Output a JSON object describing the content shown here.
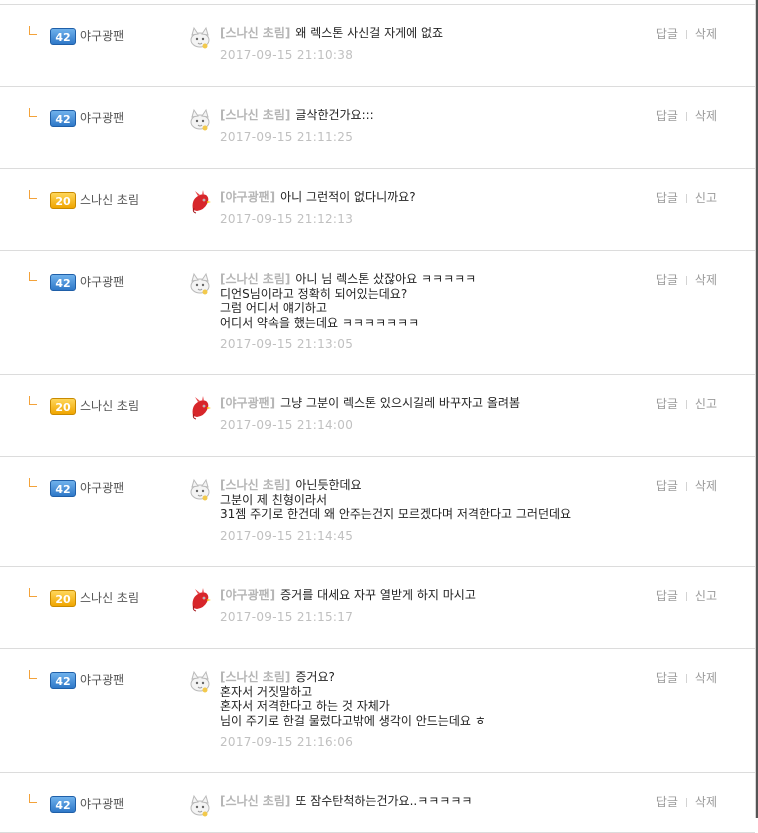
{
  "comments": [
    {
      "user_level": "42",
      "user_name": "야구광팬",
      "level_color": "blue",
      "avatar": "white-cat-avatar",
      "target": "[스나신 초림]",
      "lines": [
        "왜 렉스톤 사신걸 자게에 없죠"
      ],
      "timestamp": "2017-09-15 21:10:38",
      "reply_label": "답글",
      "action_label": "삭제"
    },
    {
      "user_level": "42",
      "user_name": "야구광팬",
      "level_color": "blue",
      "avatar": "white-cat-avatar",
      "target": "[스나신 초림]",
      "lines": [
        "글삭한건가요:::"
      ],
      "timestamp": "2017-09-15 21:11:25",
      "reply_label": "답글",
      "action_label": "삭제"
    },
    {
      "user_level": "20",
      "user_name": "스나신 초림",
      "level_color": "gold",
      "avatar": "red-bird-avatar",
      "target": "[야구광팬]",
      "lines": [
        "아니 그런적이 없다니까요?"
      ],
      "timestamp": "2017-09-15 21:12:13",
      "reply_label": "답글",
      "action_label": "신고"
    },
    {
      "user_level": "42",
      "user_name": "야구광팬",
      "level_color": "blue",
      "avatar": "white-cat-avatar",
      "target": "[스나신 초림]",
      "lines": [
        "아니 님 렉스톤 샀잖아요 ㅋㅋㅋㅋㅋ",
        "디언S님이라고 정확히 되어있는데요?",
        "그럼 어디서 얘기하고",
        "어디서 약속을 했는데요 ㅋㅋㅋㅋㅋㅋㅋ"
      ],
      "timestamp": "2017-09-15 21:13:05",
      "reply_label": "답글",
      "action_label": "삭제"
    },
    {
      "user_level": "20",
      "user_name": "스나신 초림",
      "level_color": "gold",
      "avatar": "red-bird-avatar",
      "target": "[야구광팬]",
      "lines": [
        "그냥 그분이 렉스톤 있으시길레 바꾸자고 올려봄"
      ],
      "timestamp": "2017-09-15 21:14:00",
      "reply_label": "답글",
      "action_label": "신고"
    },
    {
      "user_level": "42",
      "user_name": "야구광팬",
      "level_color": "blue",
      "avatar": "white-cat-avatar",
      "target": "[스나신 초림]",
      "lines": [
        "아닌듯한데요",
        "그분이 제 친형이라서",
        "31젬 주기로 한건데 왜 안주는건지 모르겠다며 저격한다고 그러던데요"
      ],
      "timestamp": "2017-09-15 21:14:45",
      "reply_label": "답글",
      "action_label": "삭제"
    },
    {
      "user_level": "20",
      "user_name": "스나신 초림",
      "level_color": "gold",
      "avatar": "red-bird-avatar",
      "target": "[야구광팬]",
      "lines": [
        "증거를 대세요 자꾸 열받게 하지 마시고"
      ],
      "timestamp": "2017-09-15 21:15:17",
      "reply_label": "답글",
      "action_label": "신고"
    },
    {
      "user_level": "42",
      "user_name": "야구광팬",
      "level_color": "blue",
      "avatar": "white-cat-avatar",
      "target": "[스나신 초림]",
      "lines": [
        "증거요?",
        "혼자서 거짓말하고",
        "혼자서 저격한다고 하는 것 자체가",
        "님이 주기로 한걸 물렀다고밖에 생각이 안드는데요 ㅎ"
      ],
      "timestamp": "2017-09-15 21:16:06",
      "reply_label": "답글",
      "action_label": "삭제"
    },
    {
      "user_level": "42",
      "user_name": "야구광팬",
      "level_color": "blue",
      "avatar": "white-cat-avatar",
      "target": "[스나신 초림]",
      "lines": [
        "또 잠수탄척하는건가요..ㅋㅋㅋㅋㅋ"
      ],
      "timestamp": "",
      "reply_label": "답글",
      "action_label": "삭제"
    }
  ]
}
